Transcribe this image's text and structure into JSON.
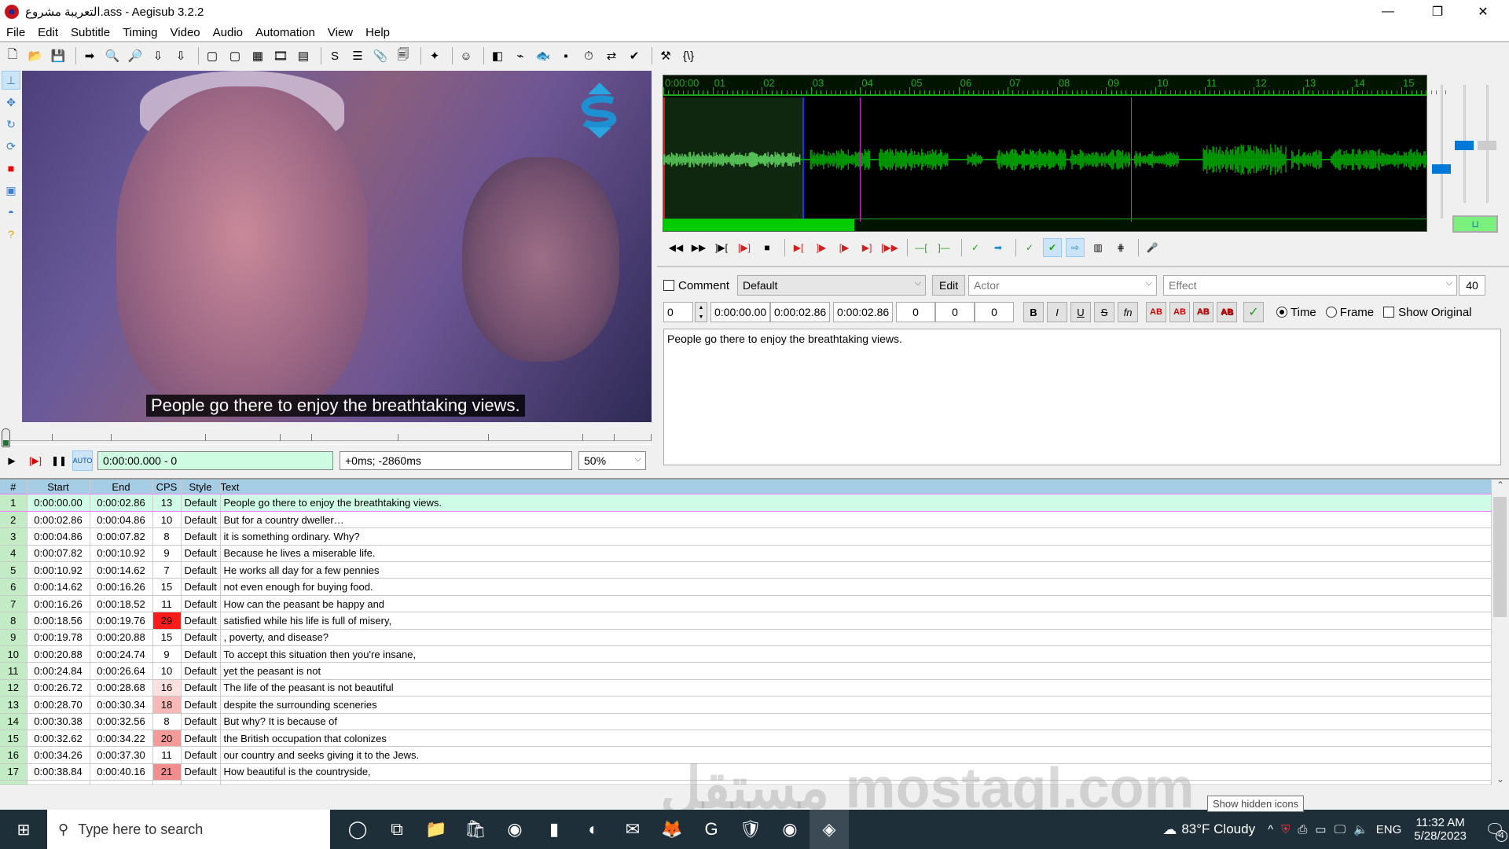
{
  "window": {
    "title": "التعريبة مشروع.ass - Aegisub 3.2.2",
    "controls": {
      "minimize": "—",
      "restore": "❐",
      "close": "✕"
    }
  },
  "menu": [
    "File",
    "Edit",
    "Subtitle",
    "Timing",
    "Video",
    "Audio",
    "Automation",
    "View",
    "Help"
  ],
  "toolbar": {
    "icons": [
      {
        "name": "new-file-icon",
        "glyph": "🗋"
      },
      {
        "name": "open-file-icon",
        "glyph": "📂"
      },
      {
        "name": "save-file-icon",
        "glyph": "💾"
      },
      "sep",
      {
        "name": "jump-to-icon",
        "glyph": "➡"
      },
      {
        "name": "zoom-in-icon",
        "glyph": "🔍"
      },
      {
        "name": "zoom-out-icon",
        "glyph": "🔎"
      },
      {
        "name": "set-start-video-icon",
        "glyph": "⇩"
      },
      {
        "name": "set-end-video-icon",
        "glyph": "⇩"
      },
      "sep",
      {
        "name": "snap-start-icon",
        "glyph": "▢"
      },
      {
        "name": "snap-end-icon",
        "glyph": "▢"
      },
      {
        "name": "video-details-icon",
        "glyph": "▦"
      },
      {
        "name": "film-icon",
        "glyph": "🎞"
      },
      {
        "name": "keyframes-icon",
        "glyph": "▤"
      },
      "sep",
      {
        "name": "styles-manager-icon",
        "glyph": "S"
      },
      {
        "name": "properties-icon",
        "glyph": "☰"
      },
      {
        "name": "attachments-icon",
        "glyph": "📎"
      },
      {
        "name": "fonts-collector-icon",
        "glyph": "🗐"
      },
      "sep",
      {
        "name": "automation-icon",
        "glyph": "✦"
      },
      "sep",
      {
        "name": "assistant-icon",
        "glyph": "☺"
      },
      "sep",
      {
        "name": "resample-icon",
        "glyph": "◧"
      },
      {
        "name": "timing-postprocessor-icon",
        "glyph": "⌁"
      },
      {
        "name": "kanji-timer-icon",
        "glyph": "🐟"
      },
      {
        "name": "select-icon",
        "glyph": "▪"
      },
      {
        "name": "shift-times-icon",
        "glyph": "⏱"
      },
      {
        "name": "translation-icon",
        "glyph": "⇄"
      },
      {
        "name": "spellcheck-icon",
        "glyph": "✔"
      },
      "sep",
      {
        "name": "options-icon",
        "glyph": "⚒"
      },
      {
        "name": "tags-icon",
        "glyph": "{\\}"
      }
    ]
  },
  "video_tools": [
    {
      "name": "standard-tool-icon",
      "glyph": "⊥",
      "active": true
    },
    {
      "name": "drag-tool-icon",
      "glyph": "✥"
    },
    {
      "name": "rotate-z-tool-icon",
      "glyph": "↻"
    },
    {
      "name": "rotate-xy-tool-icon",
      "glyph": "⟳"
    },
    {
      "name": "scale-tool-icon",
      "glyph": "■"
    },
    {
      "name": "clip-tool-icon",
      "glyph": "▣"
    },
    {
      "name": "vector-clip-tool-icon",
      "glyph": "◓"
    },
    {
      "name": "help-icon",
      "glyph": "?"
    }
  ],
  "video": {
    "subtitle_overlay": "People go there to enjoy the breathtaking views.",
    "time_display": "0:00:00.000 - 0",
    "offset_display": "+0ms; -2860ms",
    "zoom": "50%",
    "controls": {
      "play": "▶",
      "play_line": "[▶]",
      "pause": "❚❚",
      "autoscroll": "AUTO"
    }
  },
  "audio": {
    "ruler_labels": [
      "0:00:00",
      "01",
      "02",
      "03",
      "04",
      "05",
      "06",
      "07",
      "08",
      "09",
      "10",
      "11",
      "12",
      "13",
      "14",
      "15"
    ],
    "selection_start": "0:00:00.00",
    "selection_end": "0:00:02.86",
    "keyframes_seconds": [
      4.0,
      9.5
    ],
    "scroll_position_fraction": 0.25,
    "colors": {
      "waveform": "#009900",
      "selection_wave": "#55c055",
      "ruler": "#1ea81e",
      "keyframe": "#d020d0"
    },
    "toolbar": [
      {
        "name": "prev-line-icon",
        "glyph": "◀◀"
      },
      {
        "name": "next-line-icon",
        "glyph": "▶▶"
      },
      {
        "name": "play-selection-icon",
        "glyph": "]▶["
      },
      {
        "name": "play-line-icon",
        "glyph": "[▶]"
      },
      {
        "name": "stop-icon",
        "glyph": "■"
      },
      "sep",
      {
        "name": "play-before-start-icon",
        "glyph": "▶["
      },
      {
        "name": "play-after-start-icon",
        "glyph": "]▶"
      },
      {
        "name": "play-before-end-icon",
        "glyph": "[▶"
      },
      {
        "name": "play-after-end-icon",
        "glyph": "▶]"
      },
      {
        "name": "play-to-end-icon",
        "glyph": "[▶▶"
      },
      "sep",
      {
        "name": "lead-in-icon",
        "glyph": "—["
      },
      {
        "name": "lead-out-icon",
        "glyph": "]—"
      },
      "sep",
      {
        "name": "commit-icon",
        "glyph": "✓"
      },
      {
        "name": "go-to-next-icon",
        "glyph": "➡"
      },
      "sep",
      {
        "name": "auto-commit-icon",
        "glyph": "✓"
      },
      {
        "name": "auto-next-icon",
        "glyph": "✔",
        "active": true
      },
      {
        "name": "auto-scroll-icon",
        "glyph": "⇨",
        "active": true
      },
      {
        "name": "spectrum-icon",
        "glyph": "▥"
      },
      {
        "name": "video-keyframes-icon",
        "glyph": "⋕"
      },
      "sep",
      {
        "name": "karaoke-icon",
        "glyph": "🎤"
      }
    ]
  },
  "edit": {
    "comment_label": "Comment",
    "style": "Default",
    "edit_button": "Edit",
    "actor_placeholder": "Actor",
    "effect_placeholder": "Effect",
    "char_count": "40",
    "layer": "0",
    "start": "0:00:00.00",
    "end": "0:00:02.86",
    "duration": "0:00:02.86",
    "margin_l": "0",
    "margin_r": "0",
    "margin_v": "0",
    "format_buttons": {
      "bold": "B",
      "italic": "I",
      "underline": "U",
      "strike": "S",
      "font": "fn",
      "color1": "AB",
      "color2": "AB",
      "color3": "AB",
      "color4": "AB",
      "commit": "✓"
    },
    "time_label": "Time",
    "frame_label": "Frame",
    "show_original_label": "Show Original",
    "text": "People go there to enjoy the breathtaking views."
  },
  "grid": {
    "headers": [
      "#",
      "Start",
      "End",
      "CPS",
      "Style",
      "Text"
    ],
    "rows": [
      {
        "n": "1",
        "start": "0:00:00.00",
        "end": "0:00:02.86",
        "cps": "13",
        "style": "Default",
        "text": "People go there to enjoy the breathtaking views.",
        "active": true
      },
      {
        "n": "2",
        "start": "0:00:02.86",
        "end": "0:00:04.86",
        "cps": "10",
        "style": "Default",
        "text": "But for a country dweller…"
      },
      {
        "n": "3",
        "start": "0:00:04.86",
        "end": "0:00:07.82",
        "cps": "8",
        "style": "Default",
        "text": "it is something ordinary.  Why?"
      },
      {
        "n": "4",
        "start": "0:00:07.82",
        "end": "0:00:10.92",
        "cps": "9",
        "style": "Default",
        "text": "Because he lives a miserable life."
      },
      {
        "n": "5",
        "start": "0:00:10.92",
        "end": "0:00:14.62",
        "cps": "7",
        "style": "Default",
        "text": "He works all day for a few pennies"
      },
      {
        "n": "6",
        "start": "0:00:14.62",
        "end": "0:00:16.26",
        "cps": "15",
        "style": "Default",
        "text": "not even enough for buying food."
      },
      {
        "n": "7",
        "start": "0:00:16.26",
        "end": "0:00:18.52",
        "cps": "11",
        "style": "Default",
        "text": "How can the peasant be happy and"
      },
      {
        "n": "8",
        "start": "0:00:18.56",
        "end": "0:00:19.76",
        "cps": "29",
        "style": "Default",
        "text": "satisfied while his life is full of misery,",
        "cps_color": "#ff1a1a"
      },
      {
        "n": "9",
        "start": "0:00:19.78",
        "end": "0:00:20.88",
        "cps": "15",
        "style": "Default",
        "text": ", poverty, and disease?"
      },
      {
        "n": "10",
        "start": "0:00:20.88",
        "end": "0:00:24.74",
        "cps": "9",
        "style": "Default",
        "text": "To accept this situation then you're insane,"
      },
      {
        "n": "11",
        "start": "0:00:24.84",
        "end": "0:00:26.64",
        "cps": "10",
        "style": "Default",
        "text": "yet the peasant is not"
      },
      {
        "n": "12",
        "start": "0:00:26.72",
        "end": "0:00:28.68",
        "cps": "16",
        "style": "Default",
        "text": "The life of the peasant is not beautiful",
        "cps_color": "#fde0e0"
      },
      {
        "n": "13",
        "start": "0:00:28.70",
        "end": "0:00:30.34",
        "cps": "18",
        "style": "Default",
        "text": "despite the surrounding sceneries",
        "cps_color": "#f8b8b8"
      },
      {
        "n": "14",
        "start": "0:00:30.38",
        "end": "0:00:32.56",
        "cps": "8",
        "style": "Default",
        "text": "But why?  It is because of"
      },
      {
        "n": "15",
        "start": "0:00:32.62",
        "end": "0:00:34.22",
        "cps": "20",
        "style": "Default",
        "text": "the British occupation that colonizes",
        "cps_color": "#f49a9a"
      },
      {
        "n": "16",
        "start": "0:00:34.26",
        "end": "0:00:37.30",
        "cps": "11",
        "style": "Default",
        "text": "our country and seeks giving it to the Jews."
      },
      {
        "n": "17",
        "start": "0:00:38.84",
        "end": "0:00:40.16",
        "cps": "21",
        "style": "Default",
        "text": "How beautiful is the countryside,",
        "cps_color": "#f28e8e"
      }
    ]
  },
  "taskbar": {
    "search_placeholder": "Type here to search",
    "apps": [
      {
        "name": "cortana-icon",
        "glyph": "◯"
      },
      {
        "name": "task-view-icon",
        "glyph": "⧉"
      },
      {
        "name": "file-explorer-icon",
        "glyph": "📁"
      },
      {
        "name": "store-icon",
        "glyph": "🛍"
      },
      {
        "name": "chrome-icon",
        "glyph": "◉"
      },
      {
        "name": "office-icon",
        "glyph": "▮"
      },
      {
        "name": "edge-icon",
        "glyph": "◐"
      },
      {
        "name": "mail-icon",
        "glyph": "✉"
      },
      {
        "name": "firefox-icon",
        "glyph": "🦊"
      },
      {
        "name": "grammarly-icon",
        "glyph": "G"
      },
      {
        "name": "brave-icon",
        "glyph": "🛡"
      },
      {
        "name": "chrome-2-icon",
        "glyph": "◉"
      },
      {
        "name": "aegisub-icon",
        "glyph": "◈",
        "active": true
      }
    ],
    "weather": "83°F  Cloudy",
    "language": "ENG",
    "time": "11:32 AM",
    "date": "5/28/2023",
    "notifications": "4",
    "tooltip": "Show hidden icons"
  },
  "watermark": "مستقل mostaql.com"
}
